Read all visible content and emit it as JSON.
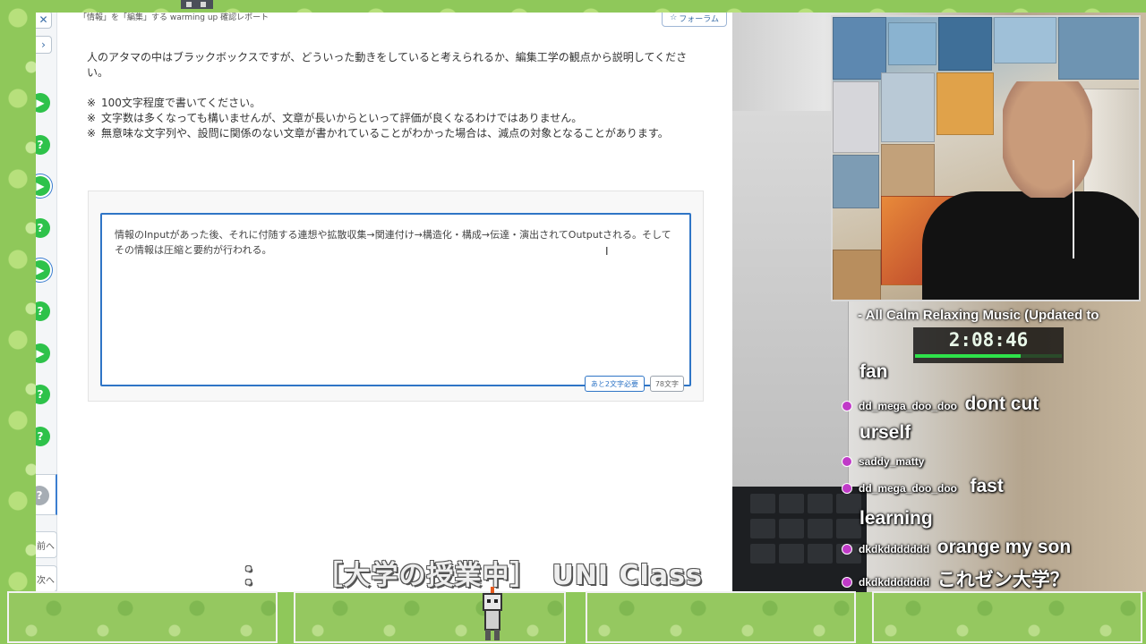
{
  "lms": {
    "header_title": "「情報」を「編集」する warming up 確認レポート",
    "forum_label": "フォーラム",
    "question": "人のアタマの中はブラックボックスですが、どういった動きをしていると考えられるか、編集工学の観点から説明してください。",
    "notes": [
      {
        "mark": "※",
        "text": "100文字程度で書いてください。"
      },
      {
        "mark": "※",
        "text": "文字数は多くなっても構いませんが、文章が長いからといって評価が良くなるわけではありません。"
      },
      {
        "mark": "※",
        "text": "無意味な文字列や、設問に関係のない文章が書かれていることがわかった場合は、減点の対象となることがあります。"
      }
    ],
    "answer_text": "情報のInputがあった後、それに付随する連想や拡散収集→関連付け→構造化・構成→伝達・演出されてOutputされる。そしてその情報は圧縮と要約が行われる。",
    "remaining_badge": "あと2文字必要",
    "char_count_badge": "78文字",
    "rail_links": [
      "前へ",
      "次へ"
    ]
  },
  "overlay": {
    "music_ticker": "- All Calm  Relaxing Music (Updated to",
    "timer": "2:08:46",
    "timer_progress": 0.72,
    "class_caption": "［大学の授業中］　UNI Class",
    "caption_prefix": "："
  },
  "chat": [
    {
      "user": "",
      "message": "fan"
    },
    {
      "user": "dd_mega_doo_doo",
      "message": "dont cut"
    },
    {
      "user": "",
      "message": "urself"
    },
    {
      "user": "saddy_matty",
      "message": ""
    },
    {
      "user": "dd_mega_doo_doo",
      "message": "fast"
    },
    {
      "user": "",
      "message": "learning"
    },
    {
      "user": "dkdkddddddd",
      "message": "orange my son"
    },
    {
      "user": "dkdkddddddd",
      "message": "これゼン大学？"
    }
  ],
  "colors": {
    "accent_blue": "#2f75c6",
    "step_green": "#2ec24a",
    "timer_green": "#2ee24a",
    "chat_badge": "#c03ac8",
    "stream_bg_green": "#8fc85a"
  },
  "icons": [
    "close-icon",
    "chevron-right-icon",
    "play-icon",
    "help-icon",
    "star-icon",
    "text-cursor-icon",
    "streamer-badge-icon"
  ]
}
